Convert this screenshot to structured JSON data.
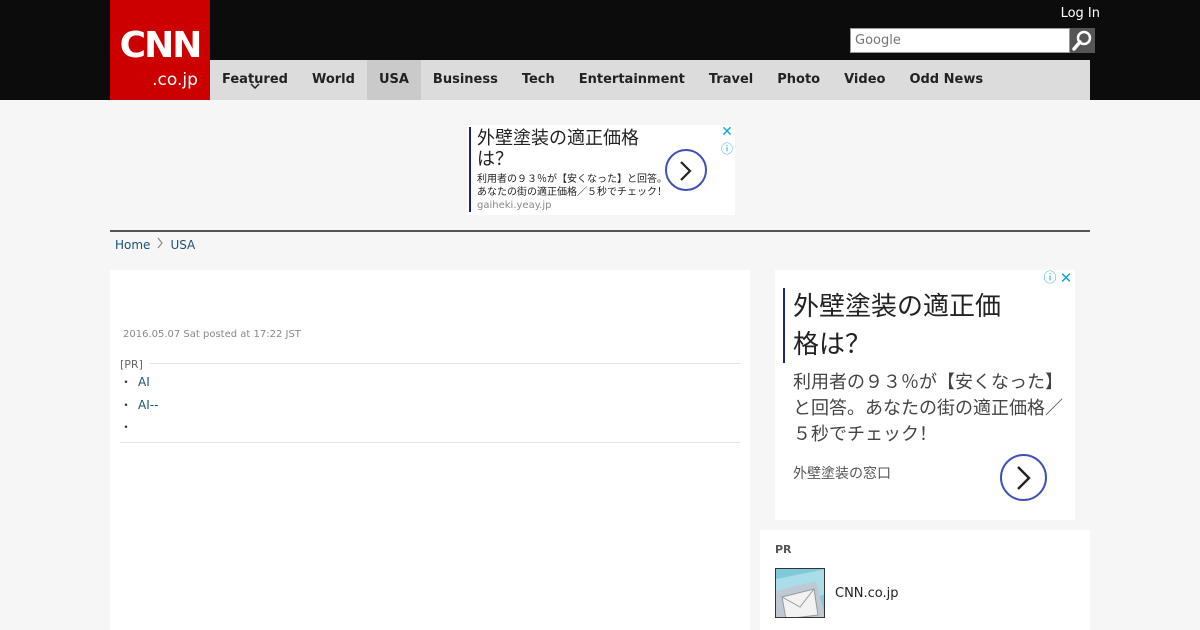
{
  "header": {
    "logo_main": "CNN",
    "logo_sub": ".co.jp",
    "login_label": "Log In",
    "search_placeholder": "Google"
  },
  "nav": {
    "items": [
      {
        "label": "Featured",
        "has_dropdown": true,
        "active": false
      },
      {
        "label": "World",
        "active": false
      },
      {
        "label": "USA",
        "active": true
      },
      {
        "label": "Business",
        "active": false
      },
      {
        "label": "Tech",
        "active": false
      },
      {
        "label": "Entertainment",
        "active": false
      },
      {
        "label": "Travel",
        "active": false
      },
      {
        "label": "Photo",
        "active": false
      },
      {
        "label": "Video",
        "active": false
      },
      {
        "label": "Odd News",
        "active": false
      }
    ]
  },
  "top_ad": {
    "headline": "外壁塗装の適正価格は？",
    "body": "利用者の９３％が【安くなった】と回答。あなたの街の適正価格／５秒でチェック！",
    "domain": "gaiheki.yeay.jp"
  },
  "breadcrumb": {
    "home": "Home",
    "current": "USA"
  },
  "article": {
    "posted": "2016.05.07 Sat posted at 17:22 JST",
    "pr_label": "[PR]",
    "pr_links": [
      "AI",
      "AI--",
      ""
    ]
  },
  "side_ad": {
    "headline": "外壁塗装の適正価格は？",
    "body": "利用者の９３％が【安くなった】と回答。あなたの街の適正価格／５秒でチェック！",
    "source": "外壁塗装の窓口"
  },
  "side_pr": {
    "label": "PR",
    "name": "CNN.co.jp"
  },
  "colors": {
    "brand_red": "#cc0000",
    "header_black": "#0c0c0c",
    "nav_gray": "#dcdcdc",
    "link_blue": "#1a5276",
    "ad_accent": "#3f51b5",
    "adchoices_cyan": "#0aa7d8"
  }
}
